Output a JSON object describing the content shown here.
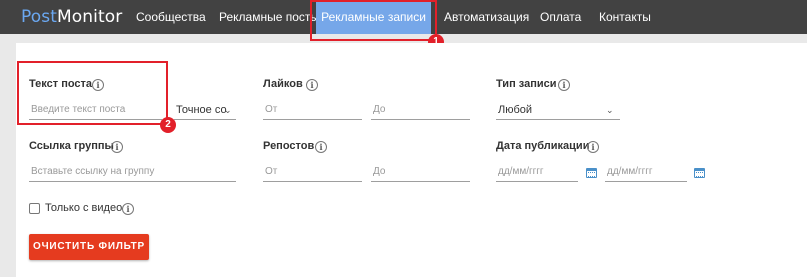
{
  "navbar": {
    "logo_part1": "Post",
    "logo_part2": "Monitor",
    "items": [
      {
        "label": "Сообщества"
      },
      {
        "label": "Рекламные посты"
      },
      {
        "label": "Рекламные записи"
      },
      {
        "label": "Автоматизация"
      },
      {
        "label": "Оплата"
      },
      {
        "label": "Контакты"
      }
    ],
    "active_index": 2,
    "callout_number": "1"
  },
  "filters": {
    "post_text": {
      "label": "Текст поста",
      "placeholder": "Введите текст поста",
      "match_mode": "Точное со",
      "callout_number": "2"
    },
    "likes": {
      "label": "Лайков",
      "from_placeholder": "От",
      "to_placeholder": "До"
    },
    "record_type": {
      "label": "Тип записи",
      "value": "Любой"
    },
    "group_link": {
      "label": "Ссылка группы",
      "placeholder": "Вставьте ссылку на группу"
    },
    "reposts": {
      "label": "Репостов",
      "from_placeholder": "От",
      "to_placeholder": "До"
    },
    "publish_date": {
      "label": "Дата публикации",
      "from_placeholder": "дд/мм/гггг",
      "to_placeholder": "дд/мм/гггг"
    },
    "video_only": {
      "label": "Только с видео",
      "checked": false
    },
    "clear_button": "ОЧИСТИТЬ ФИЛЬТР"
  },
  "colors": {
    "navbar_bg": "#424242",
    "active_tab": "#76a7e9",
    "callout": "#e2202a",
    "clear_button": "#e53b1f"
  },
  "icons": [
    "info-icon",
    "chevron-down-icon",
    "calendar-icon",
    "checkbox"
  ]
}
